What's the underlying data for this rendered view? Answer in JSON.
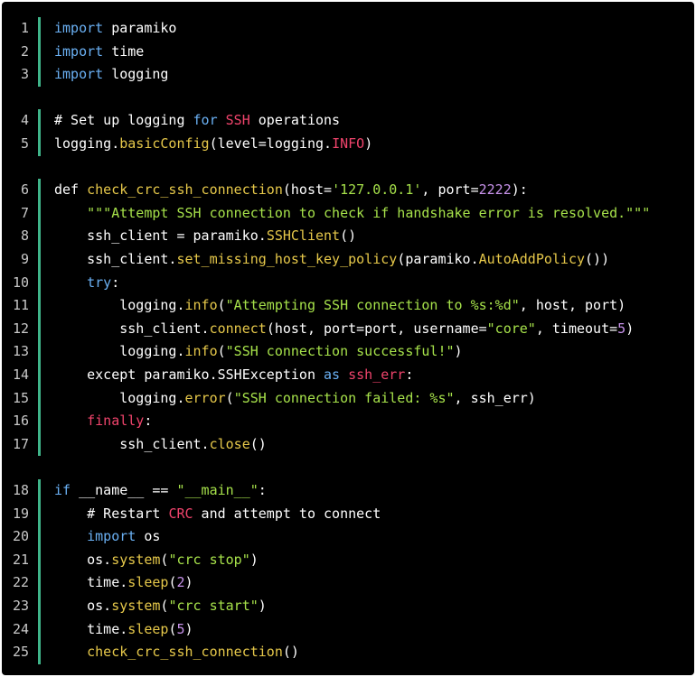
{
  "colors": {
    "background": "#000000",
    "gutter_bar": "#3fb489",
    "line_number": "#c8c8c8",
    "plain": "#ffffff",
    "keyword": "#6ab0f3",
    "function": "#e6c84a",
    "string": "#a6e14a",
    "number": "#c792ea",
    "highlight_red": "#f0446c"
  },
  "blocks": [
    {
      "lines": [
        {
          "n": "1",
          "tokens": [
            {
              "t": "import",
              "c": "kw"
            },
            {
              "t": " paramiko",
              "c": "plain"
            }
          ]
        },
        {
          "n": "2",
          "tokens": [
            {
              "t": "import",
              "c": "kw"
            },
            {
              "t": " time",
              "c": "plain"
            }
          ]
        },
        {
          "n": "3",
          "tokens": [
            {
              "t": "import",
              "c": "kw"
            },
            {
              "t": " logging",
              "c": "plain"
            }
          ]
        }
      ]
    },
    {
      "lines": [
        {
          "n": "4",
          "tokens": [
            {
              "t": "# Set up logging ",
              "c": "plain"
            },
            {
              "t": "for",
              "c": "kw"
            },
            {
              "t": " ",
              "c": "plain"
            },
            {
              "t": "SSH",
              "c": "red"
            },
            {
              "t": " operations",
              "c": "plain"
            }
          ]
        },
        {
          "n": "5",
          "tokens": [
            {
              "t": "logging.",
              "c": "plain"
            },
            {
              "t": "basicConfig",
              "c": "fn"
            },
            {
              "t": "(level=logging.",
              "c": "plain"
            },
            {
              "t": "INFO",
              "c": "red"
            },
            {
              "t": ")",
              "c": "plain"
            }
          ]
        }
      ]
    },
    {
      "lines": [
        {
          "n": "6",
          "tokens": [
            {
              "t": "def ",
              "c": "plain"
            },
            {
              "t": "check_crc_ssh_connection",
              "c": "fn"
            },
            {
              "t": "(host=",
              "c": "plain"
            },
            {
              "t": "'127.0.0.1'",
              "c": "str"
            },
            {
              "t": ", port=",
              "c": "plain"
            },
            {
              "t": "2222",
              "c": "num"
            },
            {
              "t": "):",
              "c": "plain"
            }
          ]
        },
        {
          "n": "7",
          "tokens": [
            {
              "t": "    ",
              "c": "plain"
            },
            {
              "t": "\"\"\"Attempt SSH connection to check if handshake error is resolved.\"\"\"",
              "c": "str"
            }
          ]
        },
        {
          "n": "8",
          "tokens": [
            {
              "t": "    ssh_client = paramiko.",
              "c": "plain"
            },
            {
              "t": "SSHClient",
              "c": "fn"
            },
            {
              "t": "()",
              "c": "plain"
            }
          ]
        },
        {
          "n": "9",
          "tokens": [
            {
              "t": "    ssh_client.",
              "c": "plain"
            },
            {
              "t": "set_missing_host_key_policy",
              "c": "fn"
            },
            {
              "t": "(paramiko.",
              "c": "plain"
            },
            {
              "t": "AutoAddPolicy",
              "c": "fn"
            },
            {
              "t": "())",
              "c": "plain"
            }
          ]
        },
        {
          "n": "10",
          "tokens": [
            {
              "t": "    ",
              "c": "plain"
            },
            {
              "t": "try",
              "c": "kw"
            },
            {
              "t": ":",
              "c": "plain"
            }
          ]
        },
        {
          "n": "11",
          "tokens": [
            {
              "t": "        logging.",
              "c": "plain"
            },
            {
              "t": "info",
              "c": "fn"
            },
            {
              "t": "(",
              "c": "plain"
            },
            {
              "t": "\"Attempting SSH connection to %s:%d\"",
              "c": "str"
            },
            {
              "t": ", host, port)",
              "c": "plain"
            }
          ]
        },
        {
          "n": "12",
          "tokens": [
            {
              "t": "        ssh_client.",
              "c": "plain"
            },
            {
              "t": "connect",
              "c": "fn"
            },
            {
              "t": "(host, port=port, username=",
              "c": "plain"
            },
            {
              "t": "\"core\"",
              "c": "str"
            },
            {
              "t": ", timeout=",
              "c": "plain"
            },
            {
              "t": "5",
              "c": "num"
            },
            {
              "t": ")",
              "c": "plain"
            }
          ]
        },
        {
          "n": "13",
          "tokens": [
            {
              "t": "        logging.",
              "c": "plain"
            },
            {
              "t": "info",
              "c": "fn"
            },
            {
              "t": "(",
              "c": "plain"
            },
            {
              "t": "\"SSH connection successful!\"",
              "c": "str"
            },
            {
              "t": ")",
              "c": "plain"
            }
          ]
        },
        {
          "n": "14",
          "tokens": [
            {
              "t": "    except paramiko.SSHException ",
              "c": "plain"
            },
            {
              "t": "as",
              "c": "kw"
            },
            {
              "t": " ",
              "c": "plain"
            },
            {
              "t": "ssh_err",
              "c": "red"
            },
            {
              "t": ":",
              "c": "plain"
            }
          ]
        },
        {
          "n": "15",
          "tokens": [
            {
              "t": "        logging.",
              "c": "plain"
            },
            {
              "t": "error",
              "c": "fn"
            },
            {
              "t": "(",
              "c": "plain"
            },
            {
              "t": "\"SSH connection failed: %s\"",
              "c": "str"
            },
            {
              "t": ", ssh_err)",
              "c": "plain"
            }
          ]
        },
        {
          "n": "16",
          "tokens": [
            {
              "t": "    ",
              "c": "plain"
            },
            {
              "t": "finally",
              "c": "red"
            },
            {
              "t": ":",
              "c": "plain"
            }
          ]
        },
        {
          "n": "17",
          "tokens": [
            {
              "t": "        ssh_client.",
              "c": "plain"
            },
            {
              "t": "close",
              "c": "fn"
            },
            {
              "t": "()",
              "c": "plain"
            }
          ]
        }
      ]
    },
    {
      "lines": [
        {
          "n": "18",
          "tokens": [
            {
              "t": "if",
              "c": "kw"
            },
            {
              "t": " __name__ == ",
              "c": "plain"
            },
            {
              "t": "\"__main__\"",
              "c": "str"
            },
            {
              "t": ":",
              "c": "plain"
            }
          ]
        },
        {
          "n": "19",
          "tokens": [
            {
              "t": "    # Restart ",
              "c": "plain"
            },
            {
              "t": "CRC",
              "c": "red"
            },
            {
              "t": " and attempt to connect",
              "c": "plain"
            }
          ]
        },
        {
          "n": "20",
          "tokens": [
            {
              "t": "    ",
              "c": "plain"
            },
            {
              "t": "import",
              "c": "kw"
            },
            {
              "t": " os",
              "c": "plain"
            }
          ]
        },
        {
          "n": "21",
          "tokens": [
            {
              "t": "    os.",
              "c": "plain"
            },
            {
              "t": "system",
              "c": "fn"
            },
            {
              "t": "(",
              "c": "plain"
            },
            {
              "t": "\"crc stop\"",
              "c": "str"
            },
            {
              "t": ")",
              "c": "plain"
            }
          ]
        },
        {
          "n": "22",
          "tokens": [
            {
              "t": "    time.",
              "c": "plain"
            },
            {
              "t": "sleep",
              "c": "fn"
            },
            {
              "t": "(",
              "c": "plain"
            },
            {
              "t": "2",
              "c": "num"
            },
            {
              "t": ")",
              "c": "plain"
            }
          ]
        },
        {
          "n": "23",
          "tokens": [
            {
              "t": "    os.",
              "c": "plain"
            },
            {
              "t": "system",
              "c": "fn"
            },
            {
              "t": "(",
              "c": "plain"
            },
            {
              "t": "\"crc start\"",
              "c": "str"
            },
            {
              "t": ")",
              "c": "plain"
            }
          ]
        },
        {
          "n": "24",
          "tokens": [
            {
              "t": "    time.",
              "c": "plain"
            },
            {
              "t": "sleep",
              "c": "fn"
            },
            {
              "t": "(",
              "c": "plain"
            },
            {
              "t": "5",
              "c": "num"
            },
            {
              "t": ")",
              "c": "plain"
            }
          ]
        },
        {
          "n": "25",
          "tokens": [
            {
              "t": "    ",
              "c": "plain"
            },
            {
              "t": "check_crc_ssh_connection",
              "c": "fn"
            },
            {
              "t": "()",
              "c": "plain"
            }
          ]
        }
      ]
    }
  ]
}
